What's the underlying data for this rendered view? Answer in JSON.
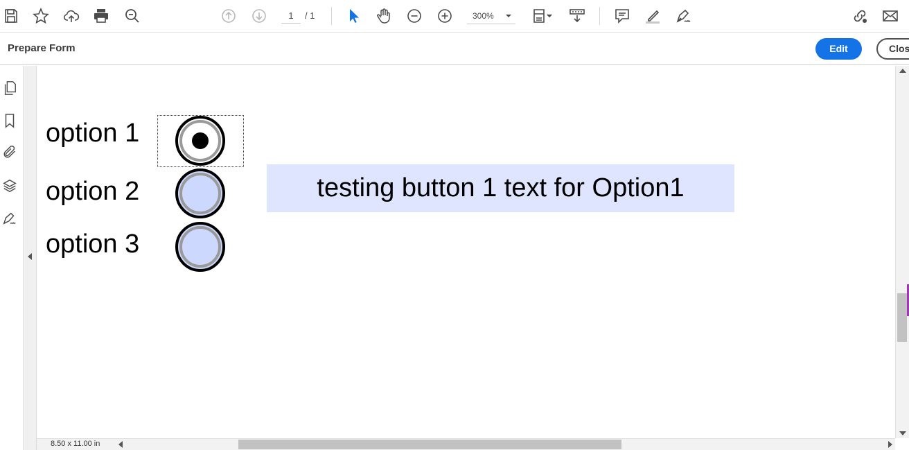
{
  "toolbar": {
    "icons": [
      "save-icon",
      "star-icon",
      "cloud-upload-icon",
      "print-icon",
      "search-zoom-icon",
      "page-up-icon",
      "page-down-icon",
      "select-cursor-icon",
      "hand-icon",
      "zoom-out-icon",
      "zoom-in-icon",
      "fit-page-icon",
      "scroll-mode-icon",
      "comment-icon",
      "highlight-icon",
      "sign-icon",
      "share-link-icon",
      "email-icon"
    ],
    "current_page": "1",
    "page_total": "/ 1",
    "zoom": "300%"
  },
  "subbar": {
    "title": "Prepare Form",
    "edit_label": "Edit",
    "close_label": "Clos"
  },
  "document": {
    "options": [
      {
        "label": "option 1",
        "selected": true
      },
      {
        "label": "option 2",
        "selected": false
      },
      {
        "label": "option 3",
        "selected": false
      }
    ],
    "text_field": "testing button 1 text for Option1",
    "colors": {
      "field_fill": "#dfe5fe",
      "radio_fill": "#cdd8fe",
      "accent": "#1473e6"
    }
  },
  "status": {
    "page_size": "8.50 x 11.00 in"
  }
}
